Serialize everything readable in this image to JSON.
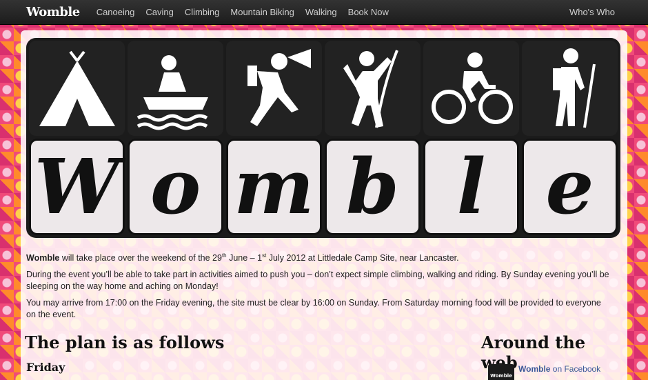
{
  "navbar": {
    "brand": "Womble",
    "items": [
      "Canoeing",
      "Caving",
      "Climbing",
      "Mountain Biking",
      "Walking",
      "Book Now"
    ],
    "right": "Who's Who"
  },
  "banner": {
    "icons": [
      "tent-icon",
      "canoe-icon",
      "caving-icon",
      "climbing-icon",
      "cycling-icon",
      "hiking-icon"
    ],
    "letters": [
      "W",
      "o",
      "m",
      "b",
      "l",
      "e"
    ]
  },
  "content": {
    "p1_brand": "Womble",
    "p1_a": " will take place over the weekend of the 29",
    "p1_sup1": "th",
    "p1_b": " June – 1",
    "p1_sup2": "st",
    "p1_c": " July 2012 at Littledale Camp Site, near Lancaster.",
    "p2": "During the event you’ll be able to take part in activities aimed to push you – don’t expect simple climbing, walking and riding. By Sunday evening you’ll be sleeping on the way home and aching on Monday!",
    "p3": "You may arrive from 17:00 on the Friday evening, the site must be clear by 16:00 on Sunday. From Saturday morning food will be provided to everyone on the event."
  },
  "plan": {
    "heading": "The plan is as follows",
    "day": "Friday"
  },
  "web": {
    "heading": "Around the web",
    "facebook_name": "Womble",
    "facebook_suffix": " on Facebook",
    "thumb_label": "Womble"
  }
}
